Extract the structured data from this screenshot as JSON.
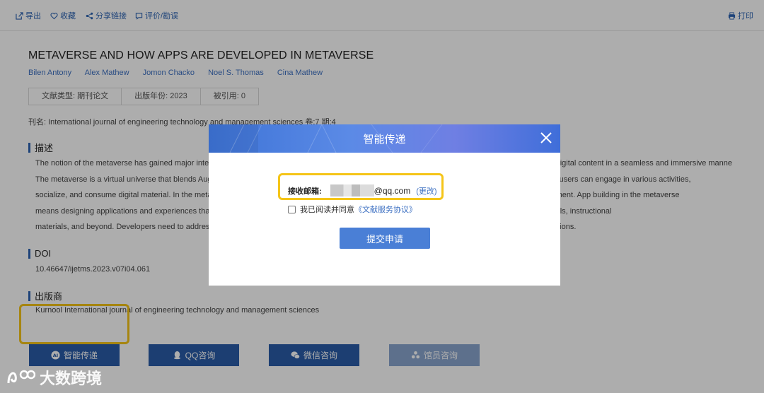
{
  "toolbar": {
    "export": "导出",
    "collect": "收藏",
    "share": "分享链接",
    "review": "评价/勘误",
    "print": "打印"
  },
  "article": {
    "title": "METAVERSE AND HOW APPS ARE DEVELOPED IN METAVERSE",
    "authors": [
      "Bilen Antony",
      "Alex Mathew",
      "Jomon Chacko",
      "Noel S. Thomas",
      "Cina Mathew"
    ],
    "meta": [
      "文献类型: 期刊论文",
      "出版年份: 2023",
      "被引用: 0"
    ],
    "journal": "刊名: International journal of engineering technology and management sciences 卷:7 期:4"
  },
  "sections": {
    "desc_title": "描述",
    "desc_lines": [
      "The notion of the metaverse has gained major interest in recent years and refers to a virtual shared space that allows users to access and engage with digital content in a seamless and immersive manner.",
      "The metaverse is a virtual universe that blends Augmented reality, virtual reality, and other immersive technologies to build a virtual shared space where users can engage in various activities,",
      "socialize, and consume digital material. In the metaverse, users can create, explore, and engage with digital content and other users in a virtual environment. App building in the metaverse",
      "means designing applications and experiences that run in these virtual worlds, ranging from games and social networking experiences to productivity tools, instructional",
      "materials, and beyond. Developers need to address a number of unique challenges and considerations to successfully design and develop such applications."
    ],
    "doi_title": "DOI",
    "doi": "10.46647/ijetms.2023.v07i04.061",
    "publisher_title": "出版商",
    "publisher": "Kurnool International journal of engineering technology and management sciences"
  },
  "buttons": {
    "smart_delivery": "智能传递",
    "qq": "QQ咨询",
    "wechat": "微信咨询",
    "librarian": "馆员咨询"
  },
  "modal": {
    "title": "智能传递",
    "email_label": "接收邮箱:",
    "email_domain": "@qq.com",
    "email_change": "(更改)",
    "agree_text": "我已阅读并同意",
    "agree_link": "《文献服务协议》",
    "submit": "提交申请",
    "agree_checked": false
  },
  "watermark": "大数跨境",
  "colors": {
    "accent": "#2a5ca8",
    "link": "#3d70c2",
    "highlight": "#f5c518"
  }
}
